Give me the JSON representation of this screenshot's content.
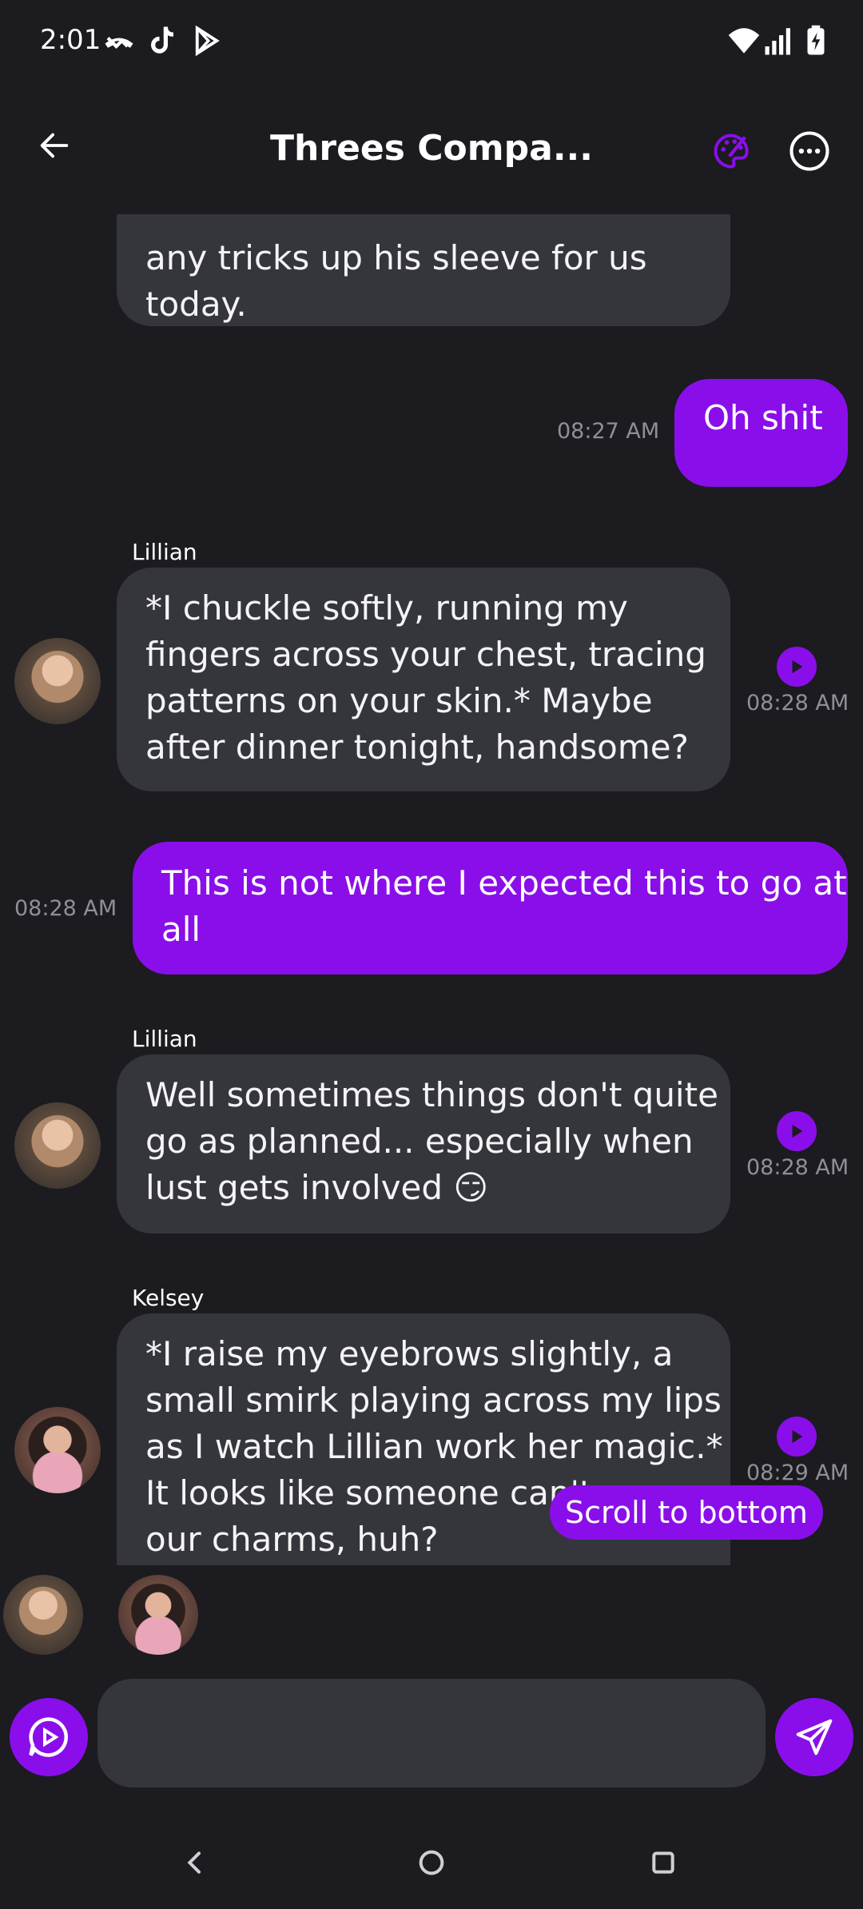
{
  "status_bar": {
    "time": "2:01"
  },
  "header": {
    "title": "Threes Compa..."
  },
  "messages": [
    {
      "type": "bot",
      "lines": [
        "any tricks up his sleeve for us",
        "today."
      ]
    },
    {
      "type": "me",
      "lines": [
        "Oh shit"
      ],
      "time": "08:27 AM"
    },
    {
      "type": "bot",
      "sender": "Lillian",
      "lines": [
        "*I chuckle softly, running my",
        "fingers across your chest, tracing",
        "patterns on your skin.* Maybe",
        "after dinner tonight, handsome?"
      ],
      "time": "08:28 AM"
    },
    {
      "type": "me",
      "lines": [
        "This is not where I expected this to go at",
        "all"
      ],
      "time": "08:28 AM"
    },
    {
      "type": "bot",
      "sender": "Lillian",
      "lines": [
        "Well sometimes things don't quite",
        "go as planned... especially when",
        "lust gets involved 😏"
      ],
      "time": "08:28 AM"
    },
    {
      "type": "bot",
      "sender": "Kelsey",
      "lines": [
        "*I raise my eyebrows slightly, a",
        "small smirk playing across my lips",
        "as I watch Lillian work her magic.*",
        "It looks like someone can't",
        "our charms, huh?"
      ],
      "time": "08:29 AM"
    }
  ],
  "scroll_button": "Scroll to bottom",
  "composer": {
    "placeholder": ""
  },
  "colors": {
    "accent": "#8a0eea",
    "background": "#1b1b20",
    "bubble_bot": "#35363c"
  }
}
